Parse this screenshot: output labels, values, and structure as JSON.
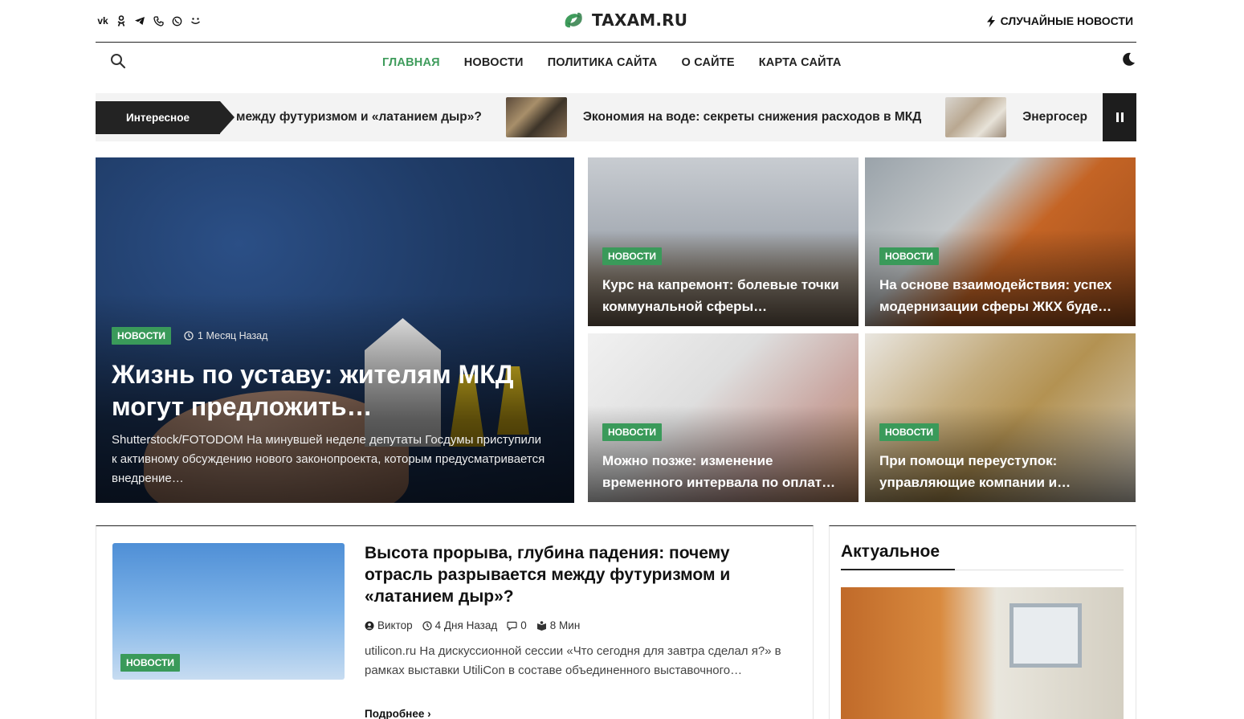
{
  "header": {
    "socials": [
      "vk-icon",
      "ok-icon",
      "telegram-icon",
      "viber-icon",
      "whatsapp-icon",
      "yandex-zen-icon"
    ],
    "logo_text": "TAXAM.RU",
    "random_news_label": "Случайные новости"
  },
  "nav": {
    "items": [
      {
        "label": "Главная",
        "active": true
      },
      {
        "label": "Новости",
        "active": false
      },
      {
        "label": "Политика сайта",
        "active": false
      },
      {
        "label": "О сайте",
        "active": false
      },
      {
        "label": "Карта сайта",
        "active": false
      }
    ]
  },
  "ticker": {
    "label": "Интересное",
    "items": [
      "между футуризмом и «латанием дыр»?",
      "Экономия на воде: секреты снижения расходов в МКД",
      "Энергосер"
    ]
  },
  "hero": {
    "badge": "Новости",
    "time": "1 Месяц Назад",
    "title": "Жизнь по уставу: жителям МКД могут предложить…",
    "excerpt": "Shutterstock/FOTODOM На минувшей неделе депутаты Госдумы приступили к активному обсуждению нового законопроекта, которым предусматривается внедрение…"
  },
  "cards": [
    {
      "badge": "Новости",
      "title": "Курс на капремонт: болевые точки коммунальной сферы…"
    },
    {
      "badge": "Новости",
      "title": "На основе взаимодействия: успех модернизации сферы ЖКХ буде…"
    },
    {
      "badge": "Новости",
      "title": "Можно позже: изменение временного интервала по оплат…"
    },
    {
      "badge": "Новости",
      "title": "При помощи переуступок: управляющие компании и…"
    }
  ],
  "article": {
    "badge": "Новости",
    "title": "Высота прорыва, глубина падения: почему отрасль разрывается между футуризмом и «латанием дыр»?",
    "author": "Виктор",
    "time": "4 Дня Назад",
    "comments": "0",
    "read_time": "8 Мин",
    "excerpt": "utilicon.ru На дискуссионной сессии «Что сегодня для завтра сделал я?» в рамках выставки UtiliCon в составе объединенного выставочного…",
    "read_more": "Подробнее"
  },
  "sidebar": {
    "title": "Актуальное"
  },
  "colors": {
    "accent": "#3f9c5c",
    "dark": "#232323",
    "hero_bg": "#1f3b66"
  }
}
